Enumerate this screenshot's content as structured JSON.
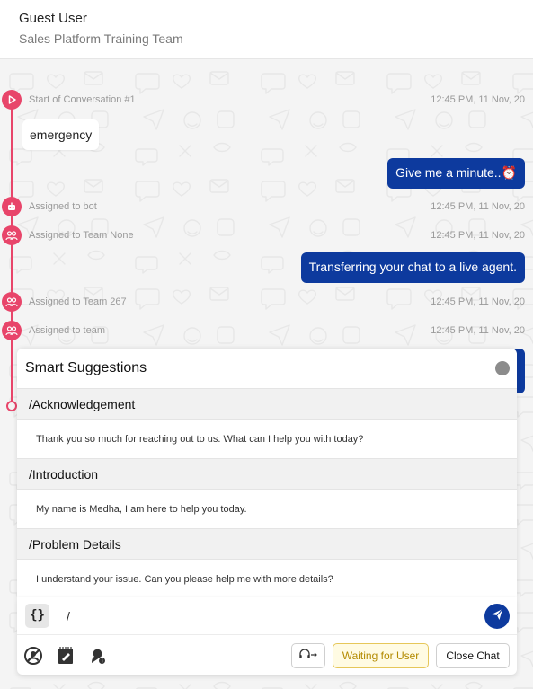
{
  "header": {
    "user_name": "Guest User",
    "team_name": "Sales Platform Training Team"
  },
  "timeline": {
    "events": [
      {
        "label": "Start of Conversation #1",
        "time": "12:45 PM, 11 Nov, 20",
        "icon": "play-icon"
      },
      {
        "label": "Assigned to bot",
        "time": "12:45 PM, 11 Nov, 20",
        "icon": "bot-icon"
      },
      {
        "label": "Assigned to Team None",
        "time": "12:45 PM, 11 Nov, 20",
        "icon": "team-icon"
      },
      {
        "label": "Assigned to Team 267",
        "time": "12:45 PM, 11 Nov, 20",
        "icon": "team-icon"
      },
      {
        "label": "Assigned to team",
        "time": "12:45 PM, 11 Nov, 20",
        "icon": "team-icon"
      }
    ]
  },
  "messages": {
    "incoming_1": "emergency",
    "outgoing_1": "Give me a minute..⏰",
    "outgoing_2": "Transferring your chat to a live agent."
  },
  "suggestions": {
    "title": "Smart Suggestions",
    "items": [
      {
        "command": "/Acknowledgement",
        "text": "Thank you so much for reaching out to us. What can I help you with today?"
      },
      {
        "command": "/Introduction",
        "text": "My name is Medha, I am here to help you today."
      },
      {
        "command": "/Problem Details",
        "text": "I understand your issue. Can you please help me with more details?"
      }
    ]
  },
  "composer": {
    "braces_label": "{}",
    "input_value": "/",
    "waiting_label": "Waiting for User",
    "close_label": "Close Chat"
  },
  "colors": {
    "accent": "#e8456a",
    "brand_blue": "#0d3a9e",
    "waiting_border": "#e6c75a"
  }
}
